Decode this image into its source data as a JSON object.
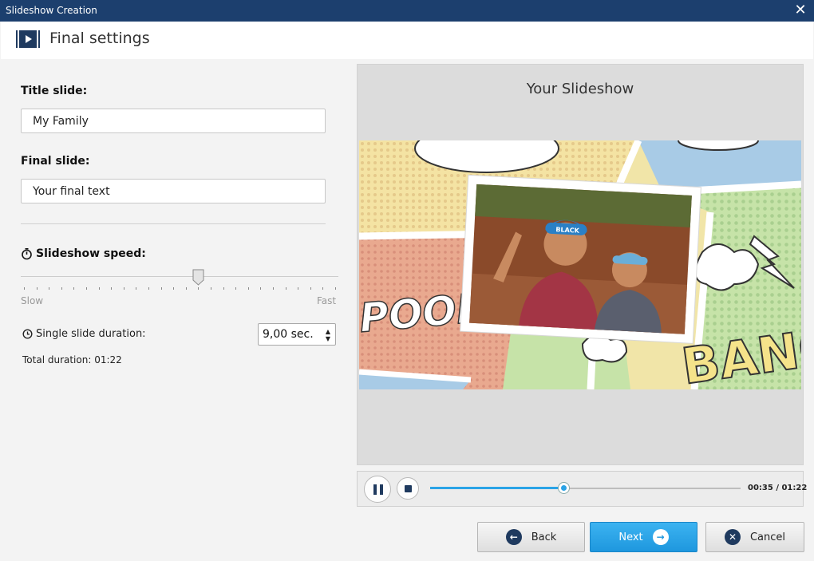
{
  "window": {
    "title": "Slideshow Creation"
  },
  "header": {
    "title": "Final settings"
  },
  "left": {
    "title_slide_label": "Title slide:",
    "title_slide_value": "My Family",
    "final_slide_label": "Final slide:",
    "final_slide_value": "Your final text",
    "speed_label": "Slideshow speed:",
    "speed_min_label": "Slow",
    "speed_max_label": "Fast",
    "speed_value": 0.56,
    "duration_label": "Single slide duration:",
    "duration_value": "9,00 sec.",
    "total_duration": "Total duration: 01:22"
  },
  "preview": {
    "title": "Your Slideshow",
    "comic_texts": [
      "POOF!",
      "BANG"
    ],
    "cap_text": "BLACK"
  },
  "player": {
    "time": "00:35 / 01:22",
    "progress": 0.43
  },
  "buttons": {
    "back": "Back",
    "next": "Next",
    "cancel": "Cancel"
  },
  "colors": {
    "titlebar": "#1c3f6e",
    "accent": "#2aa3e6",
    "icon_dark": "#1f3a5f"
  }
}
